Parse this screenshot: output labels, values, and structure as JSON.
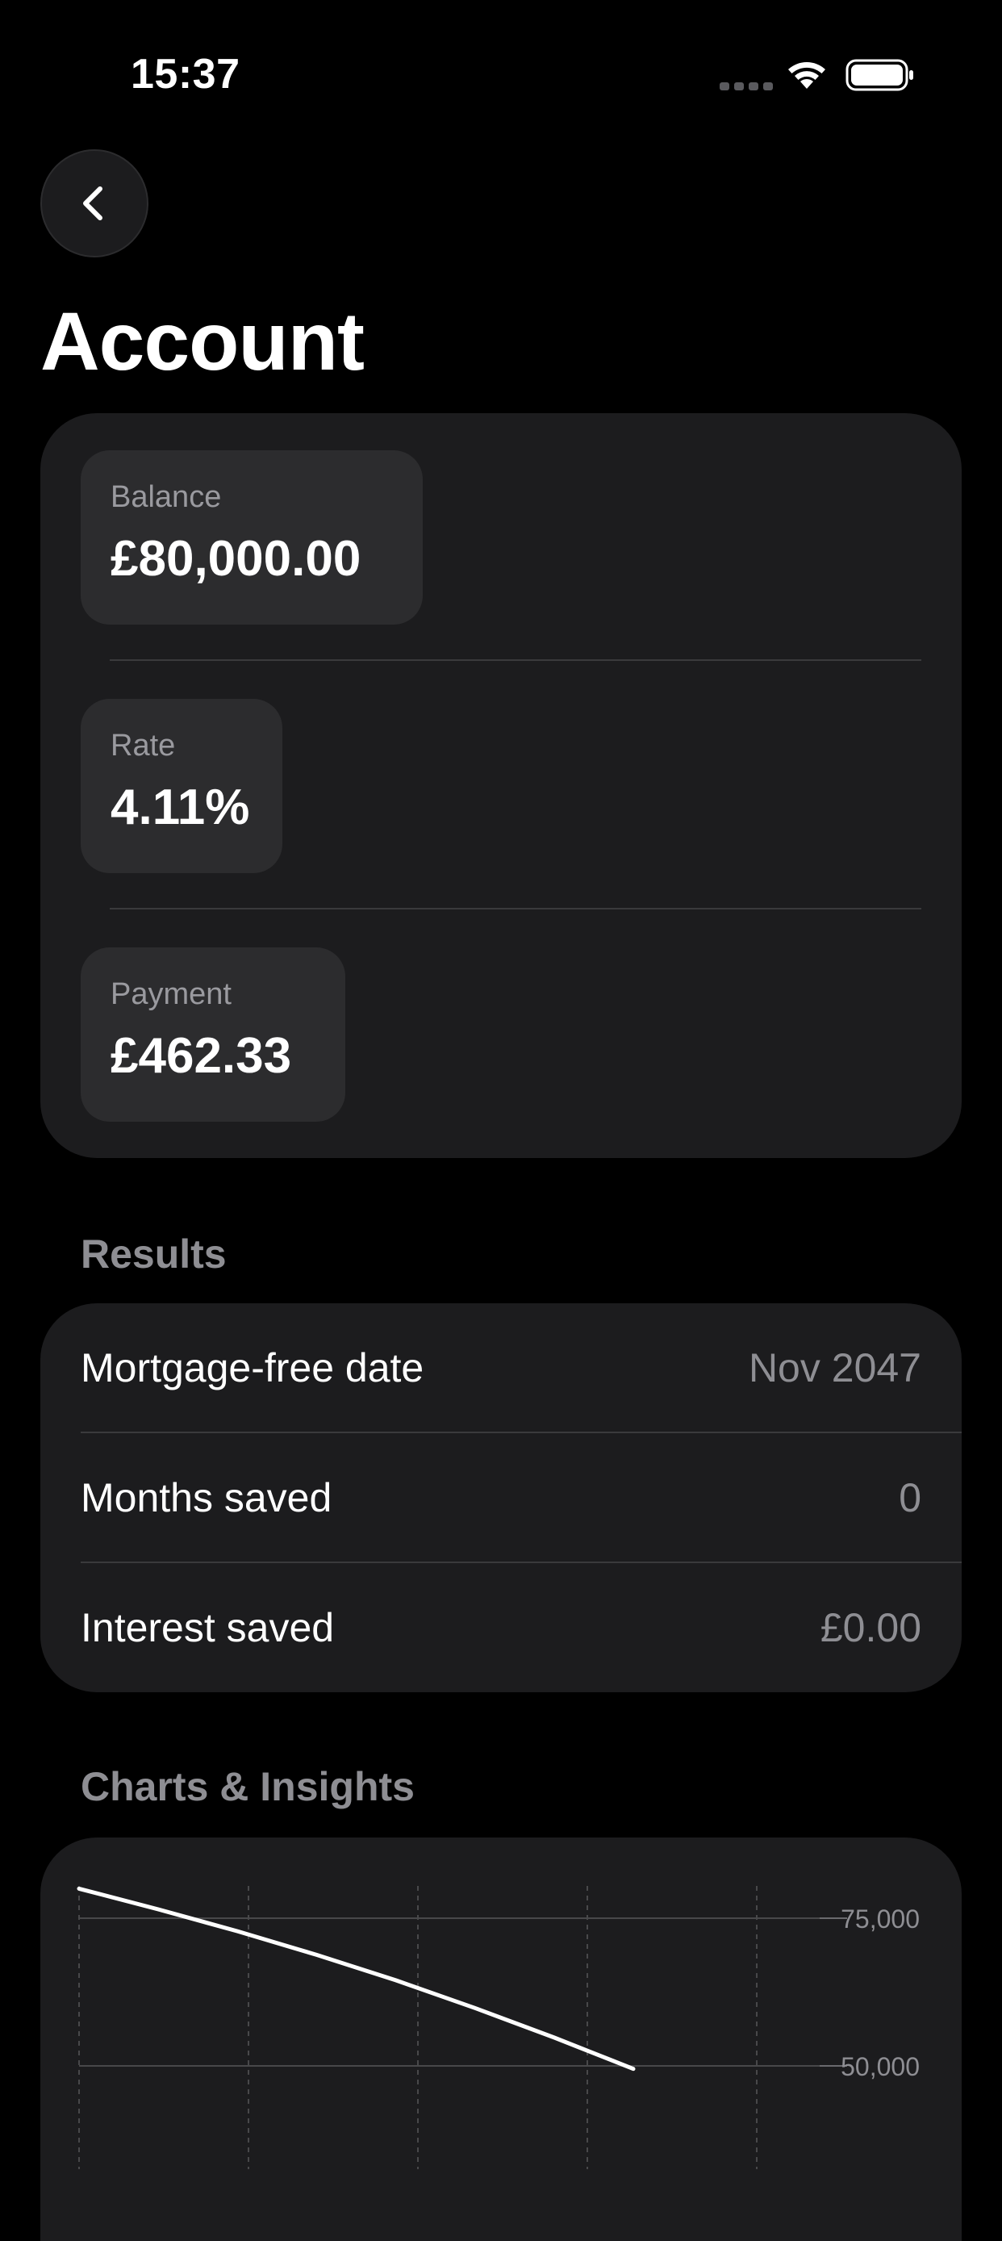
{
  "status_bar": {
    "time": "15:37",
    "icons": [
      "signal-icon",
      "wifi-icon",
      "battery-icon"
    ]
  },
  "nav": {
    "back_icon": "chevron-left-icon"
  },
  "page": {
    "title": "Account"
  },
  "inputs": [
    {
      "label": "Balance",
      "value": "£80,000.00"
    },
    {
      "label": "Rate",
      "value": "4.11%"
    },
    {
      "label": "Payment",
      "value": "£462.33"
    }
  ],
  "results": {
    "header": "Results",
    "rows": [
      {
        "label": "Mortgage-free date",
        "value": "Nov 2047"
      },
      {
        "label": "Months saved",
        "value": "0"
      },
      {
        "label": "Interest saved",
        "value": "£0.00"
      }
    ]
  },
  "charts": {
    "header": "Charts & Insights"
  },
  "chart_data": {
    "type": "line",
    "y_ticks": [
      75000,
      50000
    ],
    "y_tick_labels": [
      "75,000",
      "50,000"
    ],
    "ylim": [
      0,
      80000
    ],
    "x_gridlines": 5,
    "grid": true,
    "y_axis_position": "right",
    "series": [
      {
        "x": [
          0,
          1,
          2,
          3,
          4,
          5,
          6,
          7
        ],
        "values": [
          80000,
          76500,
          72800,
          68800,
          64500,
          59800,
          54800,
          49500
        ]
      }
    ]
  },
  "colors": {
    "background": "#000000",
    "card": "#1c1c1e",
    "chip": "#2c2c2e",
    "secondary_text": "#8e8e93",
    "divider": "#3a3a3c",
    "line": "#ffffff"
  }
}
